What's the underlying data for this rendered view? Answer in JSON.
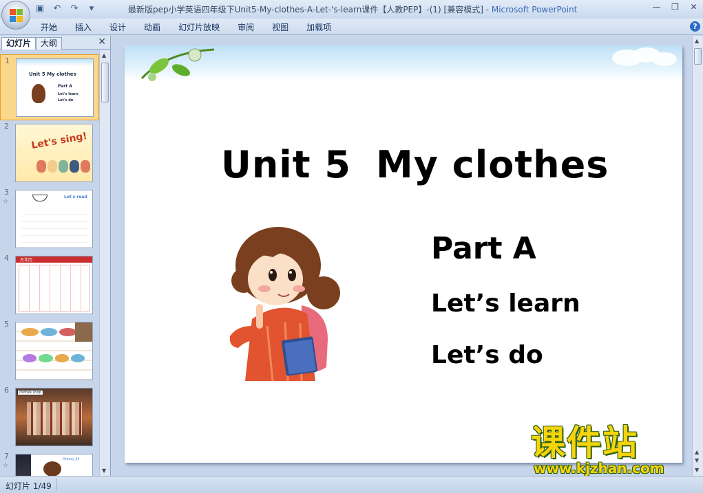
{
  "window": {
    "title_prefix": "最新版pep小学英语四年级下Unit5-My-clothes-A-Let-'s-learn课件【人教PEP】-(1) [兼容模式] - ",
    "app_name": "Microsoft PowerPoint"
  },
  "ribbon": {
    "tabs": [
      "开始",
      "插入",
      "设计",
      "动画",
      "幻灯片放映",
      "审阅",
      "视图",
      "加载项"
    ]
  },
  "left_pane": {
    "tab_slides": "幻灯片",
    "tab_outline": "大纲",
    "thumbnails": [
      {
        "num": "1",
        "selected": true,
        "title": "Unit 5   My clothes",
        "lines": [
          "Part A",
          "Let's learn",
          "Let's do"
        ]
      },
      {
        "num": "2",
        "title": "Let's sing!"
      },
      {
        "num": "3",
        "anim": "☆",
        "title": "Let's read"
      },
      {
        "num": "4",
        "title": "万年历"
      },
      {
        "num": "5"
      },
      {
        "num": "6",
        "title": "clothes shop"
      },
      {
        "num": "7",
        "anim": "☆",
        "title": "Dressy Jill"
      }
    ]
  },
  "slide": {
    "title_a": "Unit 5",
    "title_b": "My clothes",
    "part": "Part A",
    "line1": "Let’s learn",
    "line2": "Let’s do"
  },
  "watermark": {
    "cn": "课件站",
    "url": "www.kjzhan.com"
  },
  "status": {
    "slide_info": "幻灯片 1/49"
  },
  "colors": {
    "accent": "#3b6cb3",
    "selected_thumb": "#fbd78a",
    "watermark_yellow": "#f6d40b",
    "watermark_green": "#2c5e12"
  }
}
